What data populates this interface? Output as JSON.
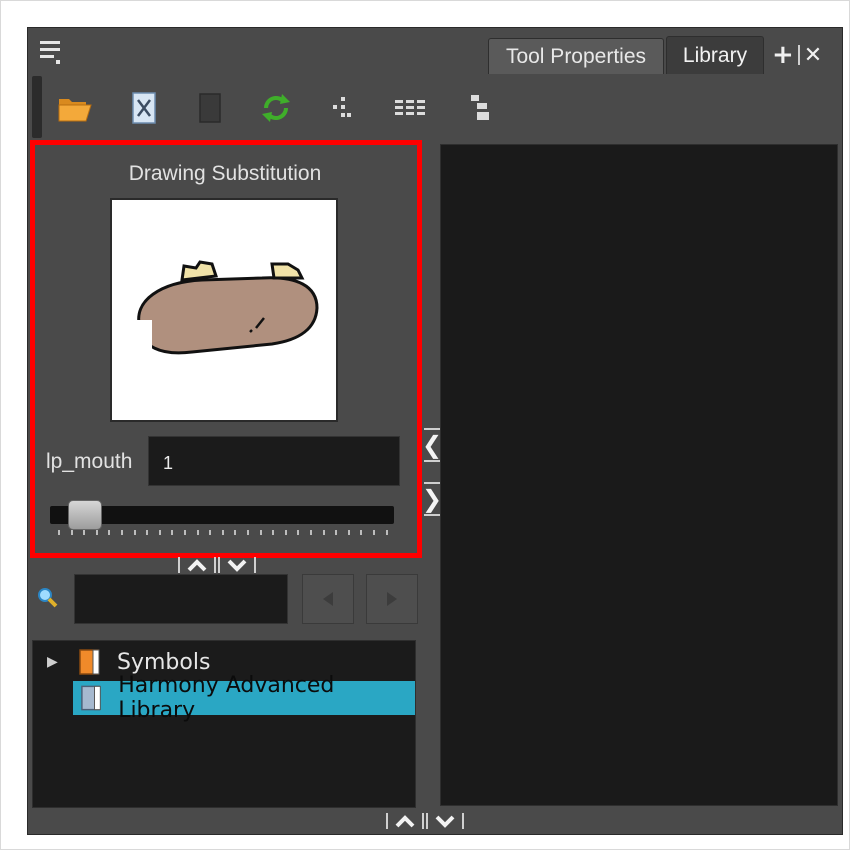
{
  "tabs": [
    {
      "label": "Tool Properties",
      "active": false
    },
    {
      "label": "Library",
      "active": true
    }
  ],
  "tab_actions": {
    "add": "+",
    "close": "✕"
  },
  "toolbar": {
    "icons": [
      "open-folder-icon",
      "delete-drawing-icon",
      "new-drawing-icon",
      "refresh-icon",
      "thumbnails-icon",
      "list-view-icon",
      "details-view-icon"
    ]
  },
  "preview": {
    "title": "Drawing Substitution",
    "param_label": "lp_mouth",
    "param_value": "1",
    "slider_position": 0
  },
  "splitter": {
    "collapse_left": "❮",
    "expand_right": "❯"
  },
  "search": {
    "value": ""
  },
  "tree": {
    "items": [
      {
        "label": "Symbols",
        "expanded": false,
        "selected": false
      },
      {
        "label": "Harmony Advanced Library",
        "selected": true
      }
    ]
  },
  "colors": {
    "panel_bg": "#4a4a4a",
    "field_bg": "#1b1b1b",
    "highlight": "#ff0000",
    "selection": "#2aa7c4"
  }
}
